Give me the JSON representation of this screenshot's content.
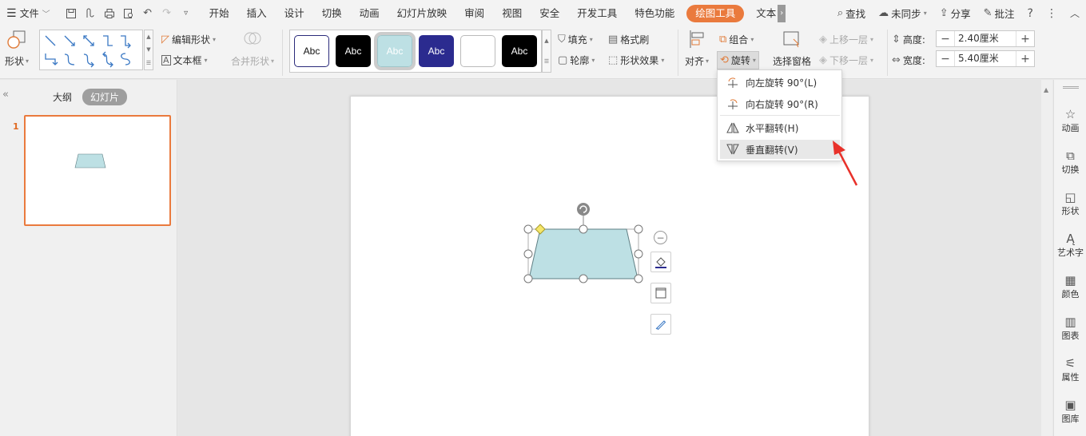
{
  "menu": {
    "file_label": "文件",
    "tabs": [
      "开始",
      "插入",
      "设计",
      "切换",
      "动画",
      "幻灯片放映",
      "审阅",
      "视图",
      "安全",
      "开发工具",
      "特色功能",
      "绘图工具",
      "文本"
    ],
    "active_tab": "绘图工具",
    "search_label": "查找",
    "sync_label": "未同步",
    "share_label": "分享",
    "comment_label": "批注"
  },
  "ribbon": {
    "shape_label": "形状",
    "edit_shape_label": "编辑形状",
    "textbox_label": "文本框",
    "merge_shape_label": "合并形状",
    "style_samples": [
      "Abc",
      "Abc",
      "Abc",
      "Abc",
      "",
      "Abc"
    ],
    "fill_label": "填充",
    "format_painter_label": "格式刷",
    "outline_label": "轮廓",
    "shape_effect_label": "形状效果",
    "align_label": "对齐",
    "group_label": "组合",
    "rotate_label": "旋转",
    "selection_pane_label": "选择窗格",
    "bring_forward_label": "上移一层",
    "send_backward_label": "下移一层",
    "height_label": "高度:",
    "height_value": "2.40厘米",
    "width_label": "宽度:",
    "width_value": "5.40厘米"
  },
  "left_panel": {
    "outline_tab": "大纲",
    "slides_tab": "幻灯片",
    "slide_number": "1"
  },
  "rotate_menu": {
    "items": [
      {
        "label": "向左旋转 90°(L)",
        "icon": "rotate-left-icon"
      },
      {
        "label": "向右旋转 90°(R)",
        "icon": "rotate-right-icon"
      },
      {
        "label": "水平翻转(H)",
        "icon": "flip-horizontal-icon"
      },
      {
        "label": "垂直翻转(V)",
        "icon": "flip-vertical-icon"
      }
    ],
    "highlighted": "垂直翻转(V)"
  },
  "sidebar": {
    "items": [
      {
        "label": "动画",
        "icon": "animation-icon"
      },
      {
        "label": "切换",
        "icon": "transition-icon"
      },
      {
        "label": "形状",
        "icon": "shape-icon"
      },
      {
        "label": "艺术字",
        "icon": "wordart-icon"
      },
      {
        "label": "颜色",
        "icon": "color-icon"
      },
      {
        "label": "图表",
        "icon": "chart-icon"
      },
      {
        "label": "属性",
        "icon": "properties-icon"
      },
      {
        "label": "图库",
        "icon": "gallery-icon"
      }
    ]
  },
  "colors": {
    "accent": "#ea7a3d",
    "shape_fill": "#bde0e4",
    "annotation_arrow": "#e8312a"
  }
}
